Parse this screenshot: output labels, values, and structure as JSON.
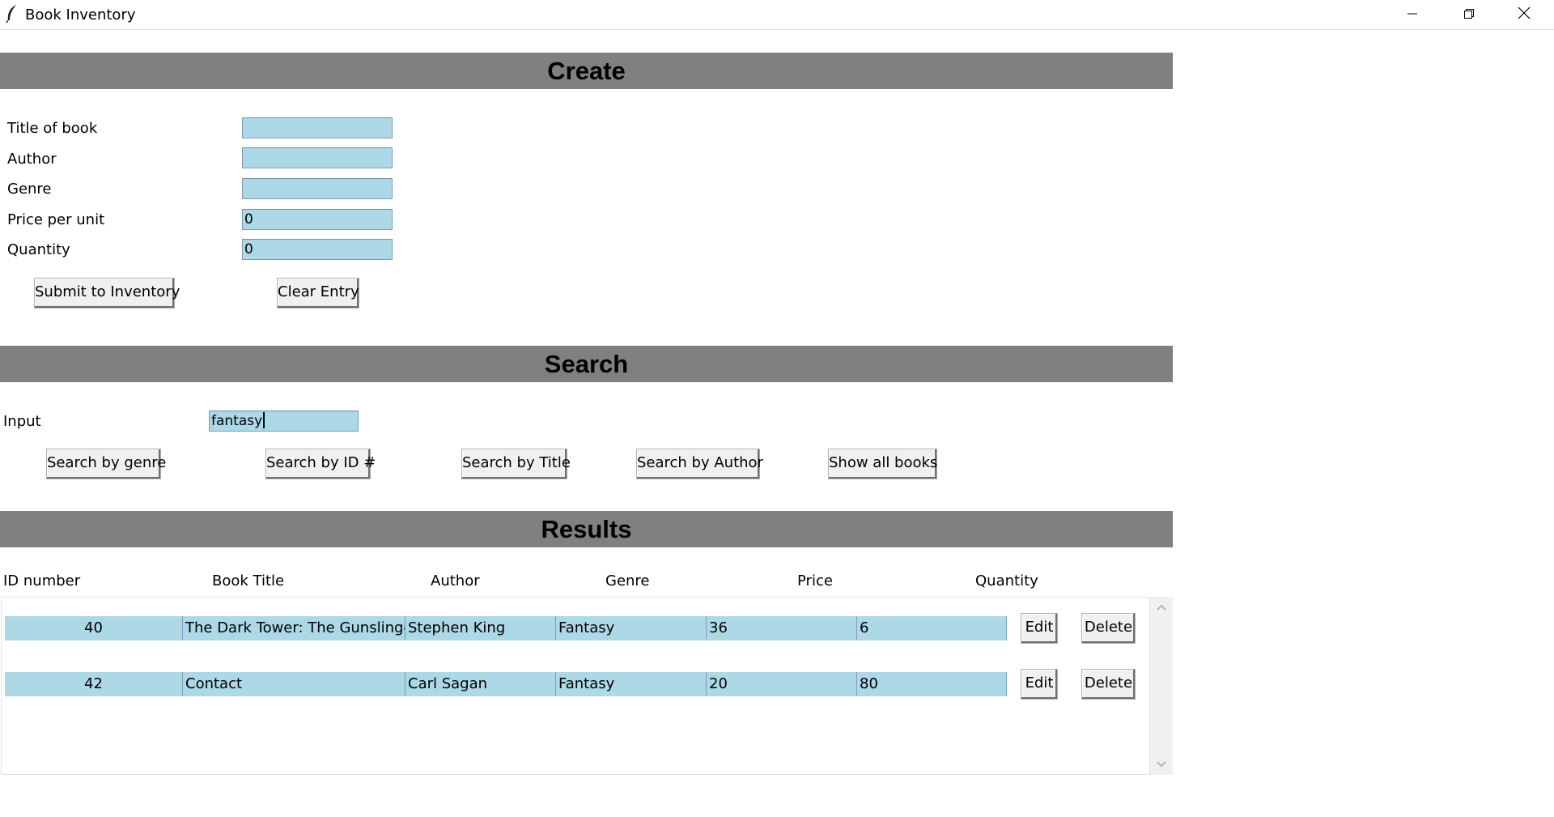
{
  "window": {
    "title": "Book Inventory"
  },
  "create": {
    "header": "Create",
    "fields": [
      {
        "label": "Title of book",
        "value": ""
      },
      {
        "label": "Author",
        "value": ""
      },
      {
        "label": "Genre",
        "value": ""
      },
      {
        "label": "Price per unit",
        "value": "0"
      },
      {
        "label": "Quantity",
        "value": "0"
      }
    ],
    "submit_label": "Submit to Inventory",
    "clear_label": "Clear Entry"
  },
  "search": {
    "header": "Search",
    "input_label": "Input",
    "input_value": "fantasy",
    "buttons": [
      "Search by genre",
      "Search by ID #",
      "Search by Title",
      "Search by Author",
      "Show all books"
    ]
  },
  "results": {
    "header": "Results",
    "columns": [
      "ID number",
      "Book Title",
      "Author",
      "Genre",
      "Price",
      "Quantity"
    ],
    "rows": [
      {
        "id": "40",
        "title": "The Dark Tower: The Gunslinger",
        "author": "Stephen King",
        "genre": "Fantasy",
        "price": "36",
        "quantity": "6"
      },
      {
        "id": "42",
        "title": "Contact",
        "author": "Carl Sagan",
        "genre": "Fantasy",
        "price": "20",
        "quantity": "80"
      }
    ],
    "edit_label": "Edit",
    "delete_label": "Delete"
  },
  "colors": {
    "header_bg": "#808080",
    "entry_bg": "#add8e6",
    "button_bg": "#f0f0f0"
  },
  "icons": {
    "app": "feather-icon",
    "minimize": "minimize-icon",
    "maximize": "restore-icon",
    "close": "close-icon",
    "scroll_up": "chevron-up-icon",
    "scroll_down": "chevron-down-icon"
  }
}
